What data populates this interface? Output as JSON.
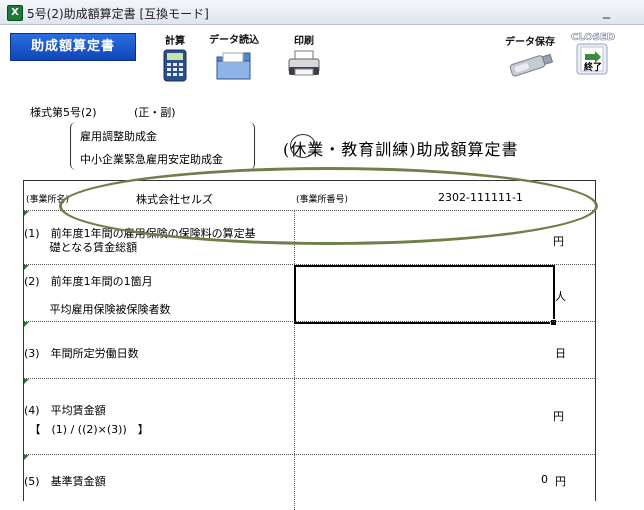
{
  "window": {
    "title": "5号(2)助成額算定書 [互換モード]",
    "app_icon": "excel-icon",
    "minimize_glyph": "_"
  },
  "toolbar": {
    "form_title": "助成額算定書",
    "calc_label": "計算",
    "import_label": "データ読込",
    "print_label": "印刷",
    "save_label": "データ保存",
    "closed_label": "CLOSED",
    "exit_label": "終了"
  },
  "form": {
    "form_number": "様式第5号(2)",
    "copy_type": "(正・副)",
    "subsidy_1": "雇用調整助成金",
    "subsidy_2": "中小企業緊急雇用安定助成金",
    "title": "(休業・教育訓練)助成額算定書",
    "header": {
      "business_name_label": "(事業所名)",
      "business_name": "株式会社セルズ",
      "business_number_label": "(事業所番号)",
      "business_number": "2302-111111-1"
    },
    "rows": [
      {
        "label_line1": "(1)　前年度1年間の雇用保険の保険料の算定基",
        "label_line2": "　　 礎となる賃金総額",
        "value": "",
        "unit": "円"
      },
      {
        "label_line1": "(2)　前年度1年間の1箇月",
        "label_line2": "　　 平均雇用保険被保険者数",
        "value": "",
        "unit": "人"
      },
      {
        "label_line1": "(3)　年間所定労働日数",
        "label_line2": "",
        "value": "",
        "unit": "日"
      },
      {
        "label_line1": "(4)　平均賃金額",
        "label_line2": "　【　(1) / ((2)×(3))　】",
        "value": "",
        "unit": "円"
      },
      {
        "label_line1": "(5)　基準賃金額",
        "label_line2": "",
        "value": "0",
        "unit": "円"
      }
    ]
  }
}
